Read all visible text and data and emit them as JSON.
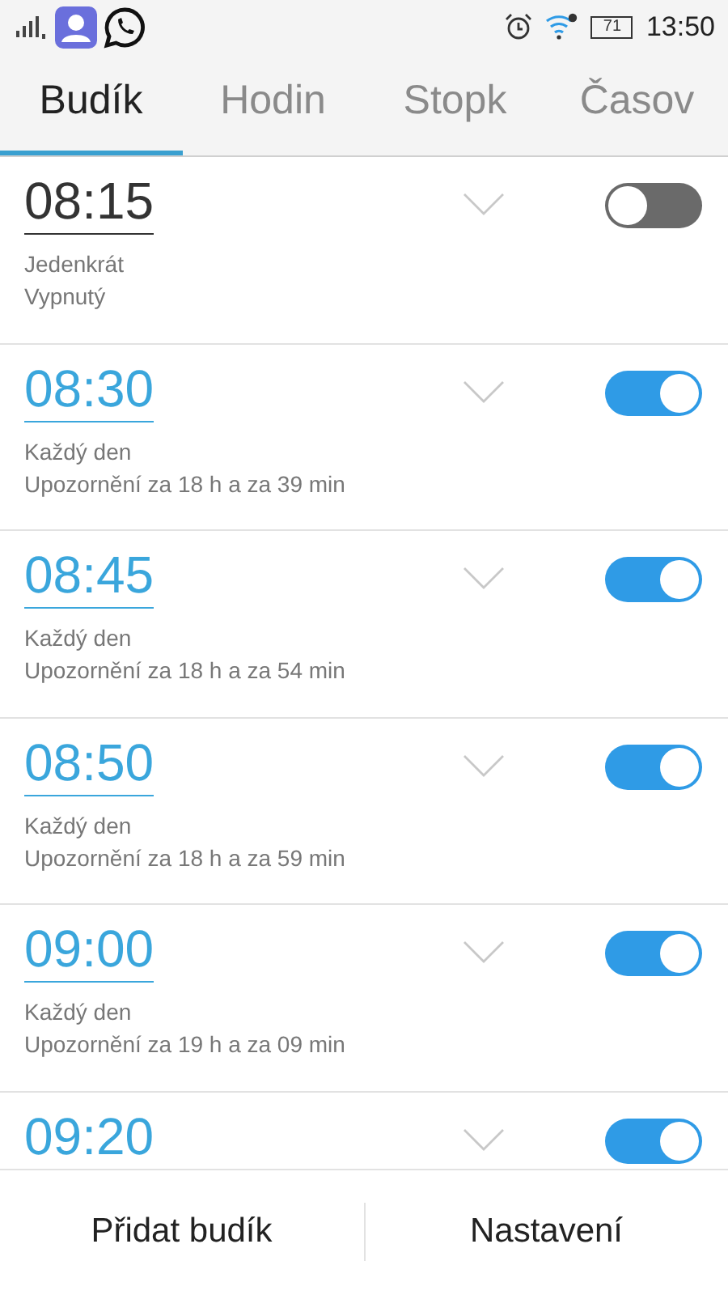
{
  "status_bar": {
    "battery": "71",
    "time": "13:50"
  },
  "tabs": [
    {
      "label": "Budík",
      "selected": true
    },
    {
      "label": "Hodin",
      "selected": false
    },
    {
      "label": "Stopk",
      "selected": false
    },
    {
      "label": "Časov",
      "selected": false
    }
  ],
  "alarms": [
    {
      "time": "08:15",
      "repeat": "Jedenkrát",
      "note": "Vypnutý",
      "on": false
    },
    {
      "time": "08:30",
      "repeat": "Každý den",
      "note": "Upozornění za 18 h a za 39 min",
      "on": true
    },
    {
      "time": "08:45",
      "repeat": "Každý den",
      "note": "Upozornění za 18 h a za 54 min",
      "on": true
    },
    {
      "time": "08:50",
      "repeat": "Každý den",
      "note": "Upozornění za 18 h a za 59 min",
      "on": true
    },
    {
      "time": "09:00",
      "repeat": "Každý den",
      "note": "Upozornění za 19 h a za 09 min",
      "on": true
    },
    {
      "time": "09:20",
      "on": true
    }
  ],
  "buttons": [
    "Přidat budík",
    "Nastavení"
  ]
}
